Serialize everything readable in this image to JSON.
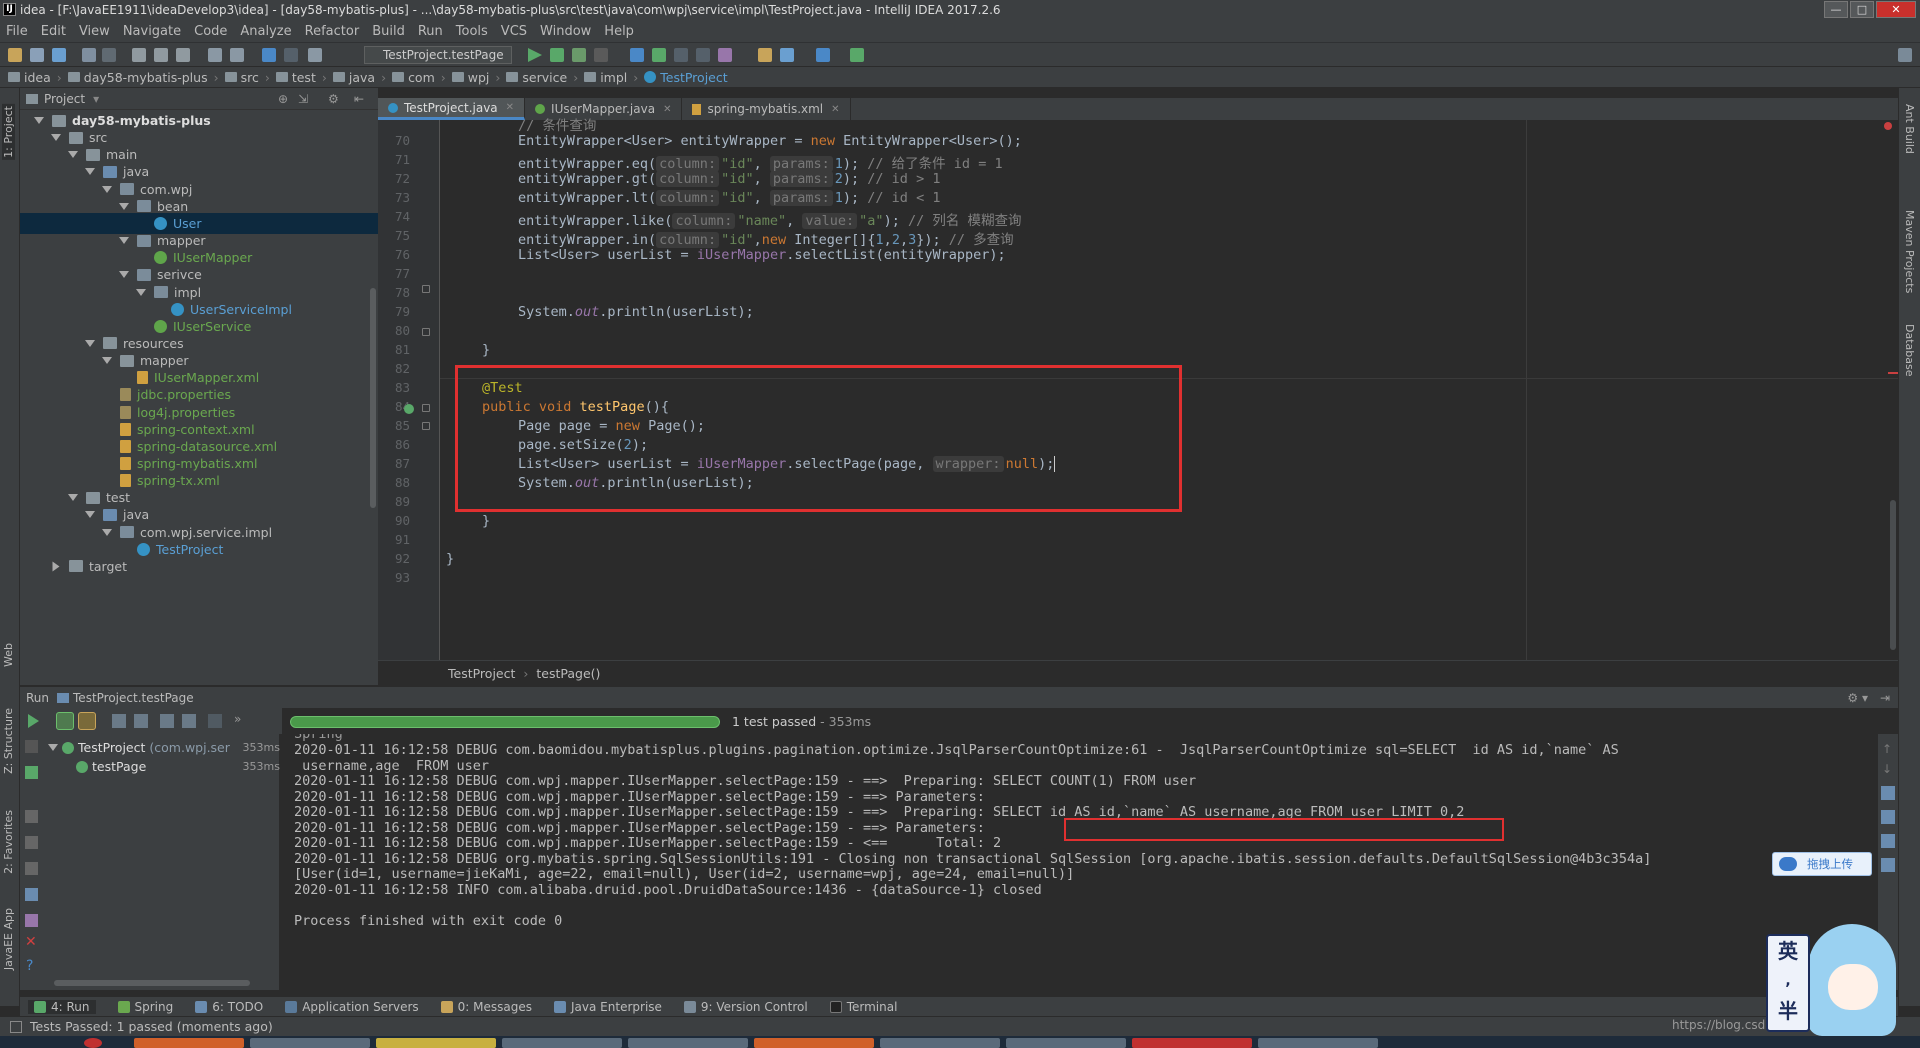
{
  "window": {
    "title": "idea - [F:\\JavaEE1911\\ideaDevelop3\\idea] - [day58-mybatis-plus] - ...\\day58-mybatis-plus\\src\\test\\java\\com\\wpj\\service\\impl\\TestProject.java - IntelliJ IDEA 2017.2.6"
  },
  "menu": [
    "File",
    "Edit",
    "View",
    "Navigate",
    "Code",
    "Analyze",
    "Refactor",
    "Build",
    "Run",
    "Tools",
    "VCS",
    "Window",
    "Help"
  ],
  "toolbar": {
    "run_config": "TestProject.testPage"
  },
  "breadcrumbs": [
    "idea",
    "day58-mybatis-plus",
    "src",
    "test",
    "java",
    "com",
    "wpj",
    "service",
    "impl",
    "TestProject"
  ],
  "left_strip": {
    "project": "1: Project",
    "structure": "Z: Structure",
    "favorites": "2: Favorites",
    "web": "Web",
    "javaee": "JavaEE App"
  },
  "right_strip": {
    "ant": "Ant Build",
    "maven": "Maven Projects",
    "database": "Database"
  },
  "project_panel": {
    "header": "Project",
    "tree": [
      {
        "label": "day58-mybatis-plus",
        "depth": 0,
        "icon": "folder",
        "bold": true
      },
      {
        "label": "src",
        "depth": 1,
        "icon": "folder"
      },
      {
        "label": "main",
        "depth": 2,
        "icon": "folder"
      },
      {
        "label": "java",
        "depth": 3,
        "icon": "src"
      },
      {
        "label": "com.wpj",
        "depth": 4,
        "icon": "pkg"
      },
      {
        "label": "bean",
        "depth": 5,
        "icon": "pkg"
      },
      {
        "label": "User",
        "depth": 6,
        "icon": "class",
        "selected": true
      },
      {
        "label": "mapper",
        "depth": 5,
        "icon": "pkg"
      },
      {
        "label": "IUserMapper",
        "depth": 6,
        "icon": "interface"
      },
      {
        "label": "serivce",
        "depth": 5,
        "icon": "pkg"
      },
      {
        "label": "impl",
        "depth": 6,
        "icon": "pkg"
      },
      {
        "label": "UserServiceImpl",
        "depth": 7,
        "icon": "class"
      },
      {
        "label": "IUserService",
        "depth": 6,
        "icon": "interface"
      },
      {
        "label": "resources",
        "depth": 3,
        "icon": "folder"
      },
      {
        "label": "mapper",
        "depth": 4,
        "icon": "folder"
      },
      {
        "label": "IUserMapper.xml",
        "depth": 5,
        "icon": "xml"
      },
      {
        "label": "jdbc.properties",
        "depth": 4,
        "icon": "file"
      },
      {
        "label": "log4j.properties",
        "depth": 4,
        "icon": "file"
      },
      {
        "label": "spring-context.xml",
        "depth": 4,
        "icon": "xml"
      },
      {
        "label": "spring-datasource.xml",
        "depth": 4,
        "icon": "xml"
      },
      {
        "label": "spring-mybatis.xml",
        "depth": 4,
        "icon": "xml"
      },
      {
        "label": "spring-tx.xml",
        "depth": 4,
        "icon": "xml"
      },
      {
        "label": "test",
        "depth": 2,
        "icon": "folder"
      },
      {
        "label": "java",
        "depth": 3,
        "icon": "src"
      },
      {
        "label": "com.wpj.service.impl",
        "depth": 4,
        "icon": "pkg"
      },
      {
        "label": "TestProject",
        "depth": 5,
        "icon": "class"
      },
      {
        "label": "target",
        "depth": 1,
        "icon": "folder"
      }
    ]
  },
  "editor_tabs": [
    {
      "label": "TestProject.java",
      "active": true
    },
    {
      "label": "IUserMapper.java",
      "active": false
    },
    {
      "label": "spring-mybatis.xml",
      "active": false
    }
  ],
  "editor": {
    "line_numbers": [
      "70",
      "71",
      "72",
      "73",
      "74",
      "75",
      "76",
      "77",
      "78",
      "79",
      "80",
      "81",
      "82",
      "83",
      "84",
      "85",
      "86",
      "87",
      "88",
      "89",
      "90",
      "91",
      "92",
      "93"
    ],
    "top_partial": "// 条件查询",
    "code": {
      "l70_a": "EntityWrapper<User> entityWrapper = ",
      "l70_kw": "new",
      "l70_b": " EntityWrapper<User>();",
      "l71_a": "entityWrapper.eq(",
      "l71_h": "column:",
      "l71_s": "\"id\"",
      "l71_c": ", ",
      "l71_h2": "params:",
      "l71_n": "1",
      "l71_d": "); ",
      "l71_cm": "// 给了条件 id = 1",
      "l72_a": "entityWrapper.gt(",
      "l72_h": "column:",
      "l72_s": "\"id\"",
      "l72_c": ", ",
      "l72_h2": "params:",
      "l72_n": "2",
      "l72_d": "); ",
      "l72_cm": "// id > 1",
      "l73_a": "entityWrapper.lt(",
      "l73_h": "column:",
      "l73_s": "\"id\"",
      "l73_c": ", ",
      "l73_h2": "params:",
      "l73_n": "1",
      "l73_d": "); ",
      "l73_cm": "// id < 1",
      "l74_a": "entityWrapper.like(",
      "l74_h": "column:",
      "l74_s": "\"name\"",
      "l74_c": ", ",
      "l74_h2": "value:",
      "l74_s2": "\"a\"",
      "l74_d": "); ",
      "l74_cm": "// 列名 模糊查询",
      "l75_a": "entityWrapper.in(",
      "l75_h": "column:",
      "l75_s": "\"id\"",
      "l75_c": ",",
      "l75_kw": "new",
      "l75_b": " Integer[]{",
      "l75_n1": "1",
      "l75_n2": "2",
      "l75_n3": "3",
      "l75_d": "}); ",
      "l75_cm": "// 多查询",
      "l76_a": "List<User> userList = ",
      "l76_f": "iUserMapper",
      "l76_b": ".selectList(entityWrapper);",
      "l79_a": "System.",
      "l79_o": "out",
      "l79_b": ".println(userList);",
      "l81": "}",
      "l83": "@Test",
      "l84_kw": "public void ",
      "l84_fn": "testPage",
      "l84_b": "(){",
      "l85_a": "Page page = ",
      "l85_kw": "new",
      "l85_b": " Page();",
      "l86_a": "page.setSize(",
      "l86_n": "2",
      "l86_b": ");",
      "l87_a": "List<User> userList = ",
      "l87_f": "iUserMapper",
      "l87_b": ".selectPage(page, ",
      "l87_h": "wrapper:",
      "l87_kw": "null",
      "l87_c": ");",
      "l88_a": "System.",
      "l88_o": "out",
      "l88_b": ".println(userList);",
      "l90": "}",
      "l92": "}"
    }
  },
  "editor_breadcrumb": [
    "TestProject",
    "testPage()"
  ],
  "run_panel": {
    "header": "Run",
    "config": "TestProject.testPage",
    "status": "1 test passed",
    "duration": " - 353ms",
    "progress": 1.0,
    "tree": [
      {
        "label": "TestProject",
        "extra": "(com.wpj.ser",
        "time": "353ms"
      },
      {
        "label": "testPage",
        "extra": "",
        "time": "353ms"
      }
    ]
  },
  "console": {
    "top_partial": "Spring",
    "lines": [
      "2020-01-11 16:12:58 DEBUG com.baomidou.mybatisplus.plugins.pagination.optimize.JsqlParserCountOptimize:61 -  JsqlParserCountOptimize sql=SELECT  id AS id,`name` AS",
      " username,age  FROM user",
      "2020-01-11 16:12:58 DEBUG com.wpj.mapper.IUserMapper.selectPage:159 - ==>  Preparing: SELECT COUNT(1) FROM user",
      "2020-01-11 16:12:58 DEBUG com.wpj.mapper.IUserMapper.selectPage:159 - ==> Parameters: ",
      "2020-01-11 16:12:58 DEBUG com.wpj.mapper.IUserMapper.selectPage:159 - ==>  Preparing: SELECT id AS id,`name` AS username,age FROM user LIMIT 0,2",
      "2020-01-11 16:12:58 DEBUG com.wpj.mapper.IUserMapper.selectPage:159 - ==> Parameters: ",
      "2020-01-11 16:12:58 DEBUG com.wpj.mapper.IUserMapper.selectPage:159 - <==      Total: 2",
      "2020-01-11 16:12:58 DEBUG org.mybatis.spring.SqlSessionUtils:191 - Closing non transactional SqlSession [org.apache.ibatis.session.defaults.DefaultSqlSession@4b3c354a]",
      "[User(id=1, username=jieKaMi, age=22, email=null), User(id=2, username=wpj, age=24, email=null)]",
      "2020-01-11 16:12:58 INFO com.alibaba.druid.pool.DruidDataSource:1436 - {dataSource-1} closed",
      "",
      "Process finished with exit code 0"
    ]
  },
  "bottom_tabs": [
    "4: Run",
    "Spring",
    "6: TODO",
    "Application Servers",
    "0: Messages",
    "Java Enterprise",
    "9: Version Control",
    "Terminal"
  ],
  "status": "Tests Passed: 1 passed (moments ago)",
  "overlay": {
    "upload": "拖拽上传",
    "ime": "英",
    "ime2": "半",
    "watermark": "https://blog.csdn.net/Thank_Long"
  },
  "colors": {
    "accent": "#4a88c7",
    "red_highlight": "#e03030",
    "progress_green": "#4a9a4a"
  }
}
